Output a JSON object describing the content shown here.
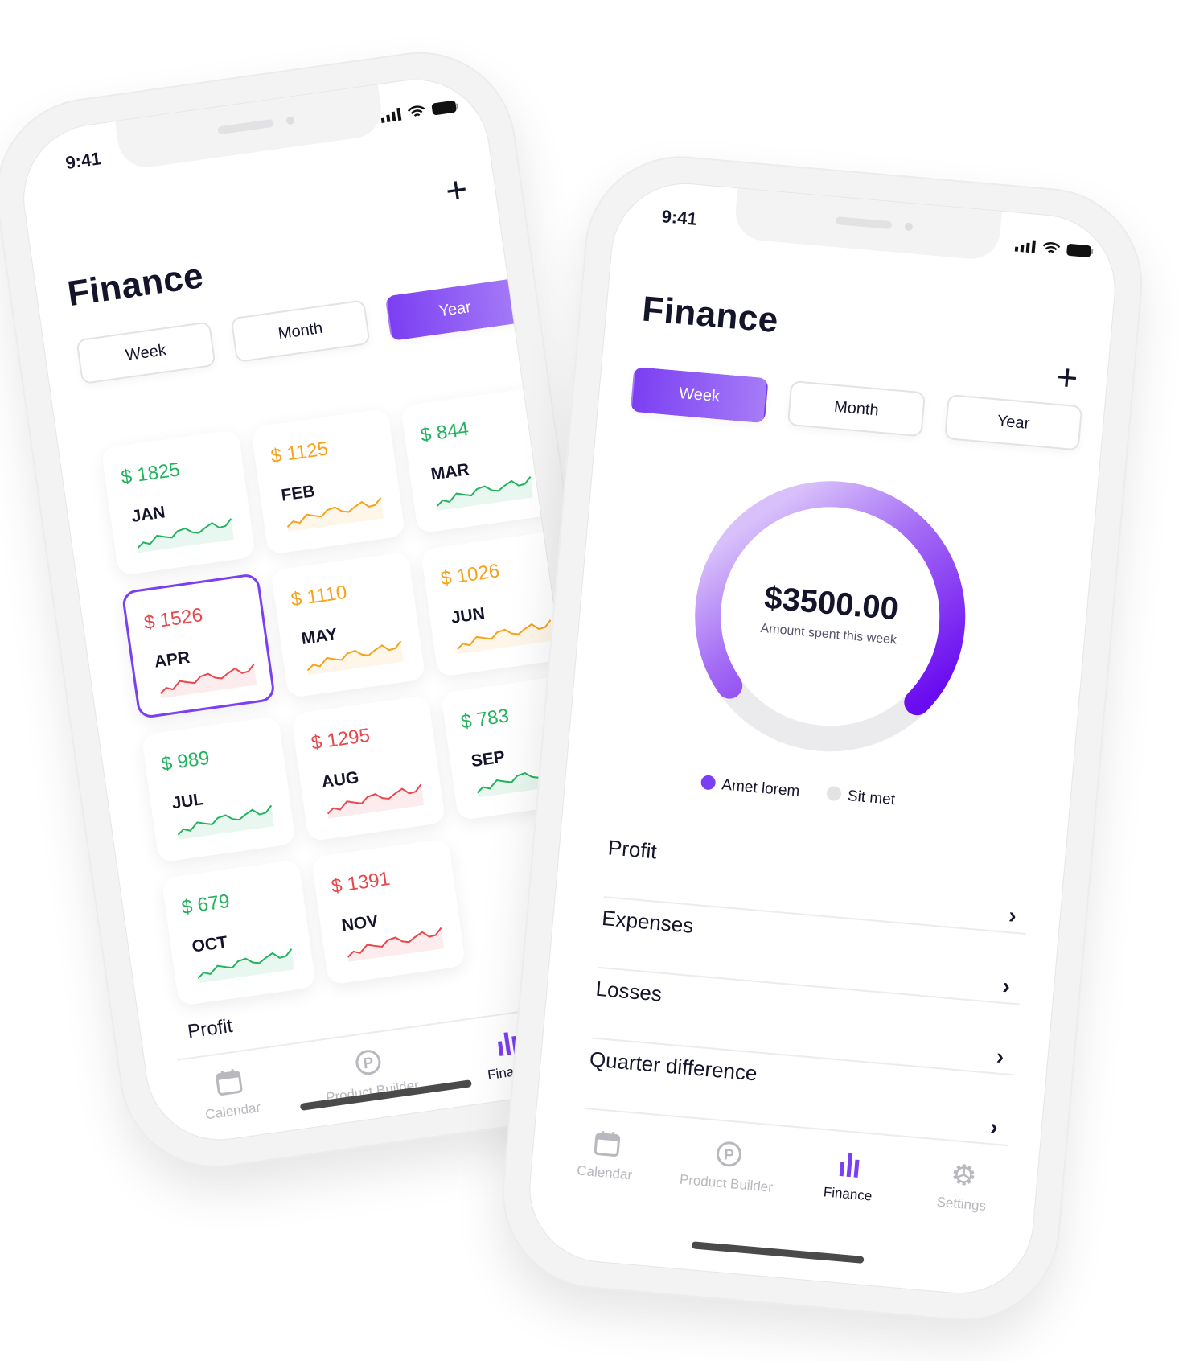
{
  "colors": {
    "accent": "#7b3ff2",
    "green": "#22b35e",
    "orange": "#f7a21b",
    "red": "#e8474c",
    "inactive": "#b8b8be",
    "track": "#ebebed"
  },
  "status_bar": {
    "time": "9:41",
    "icons": [
      "signal-icon",
      "wifi-icon",
      "battery-icon"
    ]
  },
  "left_phone": {
    "title": "Finance",
    "add_icon": "plus-icon",
    "tabs": [
      {
        "label": "Week",
        "active": false
      },
      {
        "label": "Month",
        "active": false
      },
      {
        "label": "Year",
        "active": true
      }
    ],
    "months": [
      {
        "value": "$ 1825",
        "month": "JAN",
        "status": "green"
      },
      {
        "value": "$ 1125",
        "month": "FEB",
        "status": "orange"
      },
      {
        "value": "$ 844",
        "month": "MAR",
        "status": "green"
      },
      {
        "value": "$ 1526",
        "month": "APR",
        "status": "red",
        "selected": true
      },
      {
        "value": "$ 1110",
        "month": "MAY",
        "status": "orange"
      },
      {
        "value": "$ 1026",
        "month": "JUN",
        "status": "orange"
      },
      {
        "value": "$ 989",
        "month": "JUL",
        "status": "green"
      },
      {
        "value": "$ 1295",
        "month": "AUG",
        "status": "red"
      },
      {
        "value": "$ 783",
        "month": "SEP",
        "status": "green"
      },
      {
        "value": "$ 679",
        "month": "OCT",
        "status": "green"
      },
      {
        "value": "$ 1391",
        "month": "NOV",
        "status": "red"
      }
    ],
    "section_label": "Profit",
    "nav": [
      {
        "label": "Calendar",
        "icon": "calendar-icon"
      },
      {
        "label": "Product Builder",
        "icon": "product-builder-icon"
      },
      {
        "label": "Finance",
        "icon": "bar-chart-icon",
        "active": true
      }
    ]
  },
  "right_phone": {
    "title": "Finance",
    "add_icon": "plus-icon",
    "tabs": [
      {
        "label": "Week",
        "active": true
      },
      {
        "label": "Month",
        "active": false
      },
      {
        "label": "Year",
        "active": false
      }
    ],
    "donut": {
      "amount": "$3500.00",
      "caption": "Amount spent this week",
      "fill_fraction": 0.72
    },
    "legend": [
      {
        "label": "Amet lorem",
        "color": "#7b3ff2"
      },
      {
        "label": "Sit met",
        "color": "#e3e3e6"
      }
    ],
    "rows": [
      {
        "label": "Profit"
      },
      {
        "label": "Expenses"
      },
      {
        "label": "Losses"
      },
      {
        "label": "Quarter difference"
      }
    ],
    "nav": [
      {
        "label": "Calendar",
        "icon": "calendar-icon"
      },
      {
        "label": "Product Builder",
        "icon": "product-builder-icon"
      },
      {
        "label": "Finance",
        "icon": "bar-chart-icon",
        "active": true
      },
      {
        "label": "Settings",
        "icon": "gear-icon"
      }
    ]
  }
}
